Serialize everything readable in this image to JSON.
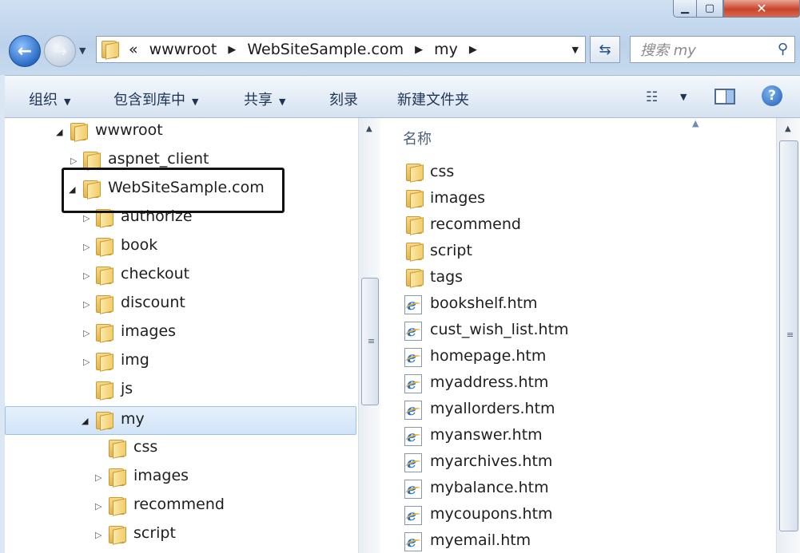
{
  "address_bar": {
    "overflow_glyph": "«",
    "crumbs": [
      "wwwroot",
      "WebSiteSample.com",
      "my"
    ]
  },
  "search": {
    "placeholder": "搜索 my"
  },
  "toolbar": {
    "organize": "组织",
    "include_in_library": "包含到库中",
    "share": "共享",
    "burn": "刻录",
    "new_folder": "新建文件夹"
  },
  "nav_tree": [
    {
      "label": "wwwroot",
      "state": "expanded"
    },
    {
      "label": "aspnet_client",
      "state": "collapsed"
    },
    {
      "label": "WebSiteSample.com",
      "state": "expanded"
    },
    {
      "label": "authorize",
      "state": "collapsed"
    },
    {
      "label": "book",
      "state": "collapsed"
    },
    {
      "label": "checkout",
      "state": "collapsed"
    },
    {
      "label": "discount",
      "state": "collapsed"
    },
    {
      "label": "images",
      "state": "collapsed"
    },
    {
      "label": "img",
      "state": "collapsed"
    },
    {
      "label": "js",
      "state": "leaf"
    },
    {
      "label": "my",
      "state": "expanded",
      "selected": true
    },
    {
      "label": "css",
      "state": "leaf"
    },
    {
      "label": "images",
      "state": "collapsed"
    },
    {
      "label": "recommend",
      "state": "collapsed"
    },
    {
      "label": "script",
      "state": "collapsed"
    }
  ],
  "content": {
    "column_header": "名称",
    "items": [
      {
        "name": "css",
        "type": "folder"
      },
      {
        "name": "images",
        "type": "folder"
      },
      {
        "name": "recommend",
        "type": "folder"
      },
      {
        "name": "script",
        "type": "folder"
      },
      {
        "name": "tags",
        "type": "folder"
      },
      {
        "name": "bookshelf.htm",
        "type": "htm"
      },
      {
        "name": "cust_wish_list.htm",
        "type": "htm"
      },
      {
        "name": "homepage.htm",
        "type": "htm"
      },
      {
        "name": "myaddress.htm",
        "type": "htm"
      },
      {
        "name": "myallorders.htm",
        "type": "htm"
      },
      {
        "name": "myanswer.htm",
        "type": "htm"
      },
      {
        "name": "myarchives.htm",
        "type": "htm"
      },
      {
        "name": "mybalance.htm",
        "type": "htm"
      },
      {
        "name": "mycoupons.htm",
        "type": "htm"
      },
      {
        "name": "myemail.htm",
        "type": "htm"
      }
    ]
  },
  "colors": {
    "selection": "#d1e4f8",
    "highlight_box": "#111111",
    "folder": "#f2cc6a"
  }
}
